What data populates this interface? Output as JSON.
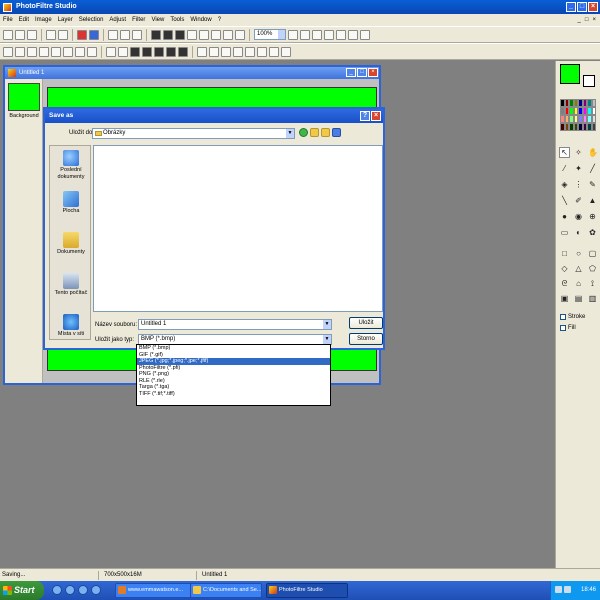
{
  "app": {
    "title": "PhotoFiltre Studio"
  },
  "menu": {
    "items": [
      "File",
      "Edit",
      "Image",
      "Layer",
      "Selection",
      "Adjust",
      "Filter",
      "View",
      "Tools",
      "Window",
      "?"
    ]
  },
  "toolbar": {
    "zoom": "100%"
  },
  "document": {
    "title": "Untitled 1",
    "layer_label": "Background",
    "canvas_color": "#00ff00"
  },
  "dialog": {
    "title": "Save as",
    "look_in_label": "Uložit do:",
    "look_in_value": "Obrázky",
    "places": [
      "Poslední dokumenty",
      "Plocha",
      "Dokumenty",
      "Tento počítač",
      "Místa v síti"
    ],
    "file_name_label": "Název souboru:",
    "file_name_value": "Untitled 1",
    "file_type_label": "Uložit jako typ:",
    "file_type_value": "BMP (*.bmp)",
    "save_button": "Uložit",
    "cancel_button": "Storno",
    "type_options": [
      "BMP (*.bmp)",
      "GIF (*.gif)",
      "JPEG (*.jpg;*.jpeg;*.jpe;*.jfif)",
      "PhotoFiltre (*.pfi)",
      "PNG (*.png)",
      "RLE (*.rle)",
      "Targa (*.tga)",
      "TIFF (*.tif;*.tiff)"
    ],
    "selected_option_index": 2
  },
  "right_panel": {
    "foreground_color": "#00ff00",
    "background_color": "#ffffff",
    "stroke_label": "Stroke",
    "fill_label": "Fill"
  },
  "statusbar": {
    "status": "Saving...",
    "dimensions": "700x500x16M",
    "doc": "Untitled 1"
  },
  "taskbar": {
    "start": "Start",
    "tasks": [
      "www.emmawatson.e...",
      "C:\\Documents and Se...",
      "PhotoFiltre Studio"
    ],
    "clock": "18:46"
  }
}
